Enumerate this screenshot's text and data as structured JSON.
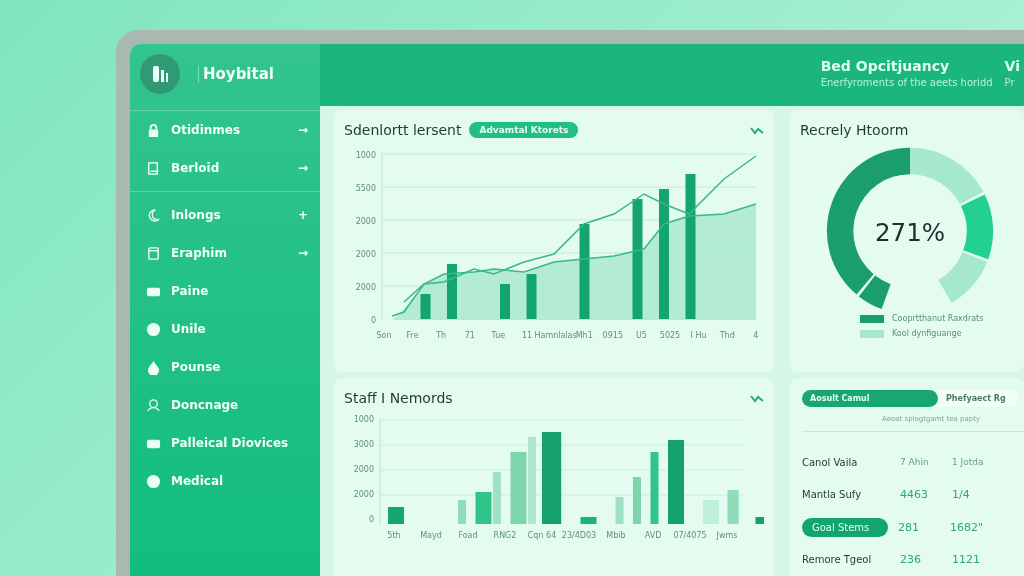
{
  "sidebar": {
    "brand": "Hoybital",
    "items": [
      {
        "label": "Otidinmes",
        "trail": "→"
      },
      {
        "label": "Berloid",
        "trail": "→"
      },
      {
        "label": "Inlongs",
        "trail": "+"
      },
      {
        "label": "Eraphim",
        "trail": "→"
      },
      {
        "label": "Paine"
      },
      {
        "label": "Unile"
      },
      {
        "label": "Pounse"
      },
      {
        "label": "Doncnage"
      },
      {
        "label": "Palleical Diovices"
      },
      {
        "label": "Medical"
      }
    ]
  },
  "header": {
    "title": "Bed Opcitjuancy",
    "subtitle": "Enerfyroments of the aeets horidd",
    "title_2": "Vi",
    "subtitle_2": "Pr"
  },
  "chart_1": {
    "title": "Sdenlortt lersent",
    "badge": "Advamtal Ktorets",
    "yticks": [
      "1000",
      "5500",
      "2000",
      "2000",
      "2000",
      "0"
    ],
    "xlabels": [
      "Son",
      "Fre",
      "Th",
      "71",
      "Tue",
      "11",
      "Hamnlalas",
      "Mh1",
      "0915",
      "U5",
      "5025",
      "I Hu",
      "Thd",
      "4"
    ]
  },
  "chart_2": {
    "title": "Staff I Nemords",
    "yticks": [
      "1000",
      "3000",
      "2000",
      "2000",
      "0"
    ],
    "xlabels": [
      "5th",
      "Mayd",
      "Foad",
      "RNG2",
      "Cqn 64",
      "23/4D03",
      "Mbib",
      "AVD",
      "07/4075",
      "Jwms"
    ]
  },
  "gauge": {
    "title": "Recrely Htoorm",
    "value": "271%",
    "legend": [
      {
        "label": "Cooprtthanut Raxdrats",
        "color": "#1a9e6e"
      },
      {
        "label": "Kool dynfiguange",
        "color": "#a6e8cc"
      }
    ]
  },
  "summary": {
    "toggle": [
      {
        "label": "Aosult Camul",
        "selected": true
      },
      {
        "label": "Phefyaect Rg",
        "selected": false
      }
    ],
    "caption": "Aeoat splogtgamt tea papty",
    "rows": [
      {
        "kind": "header",
        "cells": [
          "Canol Vaila",
          "7 Ahin",
          "1 Jotda"
        ]
      },
      {
        "kind": "plain",
        "cells": [
          "Mantla Sufy",
          "4463",
          "1/4"
        ]
      },
      {
        "kind": "pill",
        "cells": [
          "Goal Stems",
          "281",
          "1682\""
        ]
      },
      {
        "kind": "plain",
        "cells": [
          "Remore Tgeol",
          "236",
          "1121"
        ]
      }
    ]
  }
}
